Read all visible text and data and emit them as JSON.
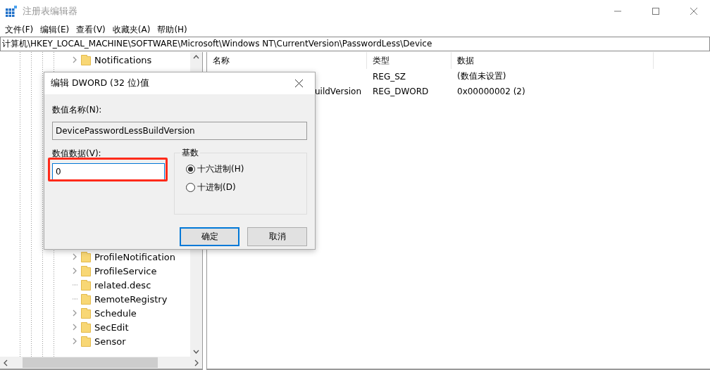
{
  "window": {
    "title": "注册表编辑器"
  },
  "menu": [
    "文件(F)",
    "编辑(E)",
    "查看(V)",
    "收藏夹(A)",
    "帮助(H)"
  ],
  "address": "计算机\\HKEY_LOCAL_MACHINE\\SOFTWARE\\Microsoft\\Windows NT\\CurrentVersion\\PasswordLess\\Device",
  "tree": {
    "items_top": [
      {
        "label": "Notifications",
        "has_children": true
      }
    ],
    "items_bottom": [
      {
        "label": "ProfileNotification",
        "has_children": true
      },
      {
        "label": "ProfileService",
        "has_children": true
      },
      {
        "label": "related.desc",
        "has_children": false
      },
      {
        "label": "RemoteRegistry",
        "has_children": false
      },
      {
        "label": "Schedule",
        "has_children": true
      },
      {
        "label": "SecEdit",
        "has_children": true
      },
      {
        "label": "Sensor",
        "has_children": true
      }
    ]
  },
  "list": {
    "columns": [
      "名称",
      "类型",
      "数据"
    ],
    "rows": [
      {
        "name": "",
        "type": "REG_SZ",
        "data": "(数值未设置)"
      },
      {
        "name": "uildVersion",
        "type": "REG_DWORD",
        "data": "0x00000002 (2)"
      }
    ]
  },
  "dialog": {
    "title": "编辑 DWORD (32 位)值",
    "name_label": "数值名称(N):",
    "name_value": "DevicePasswordLessBuildVersion",
    "data_label": "数值数据(V):",
    "data_value": "0",
    "data_highlighted": true,
    "base_label": "基数",
    "bases": [
      {
        "label": "十六进制(H)",
        "selected": true
      },
      {
        "label": "十进制(D)",
        "selected": false
      }
    ],
    "buttons": [
      {
        "label": "确定",
        "default": true
      },
      {
        "label": "取消",
        "default": false
      }
    ]
  }
}
